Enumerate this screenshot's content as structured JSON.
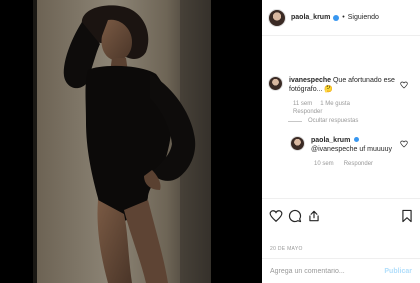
{
  "header": {
    "username": "paola_krum",
    "separator": "•",
    "follow_state": "Siguiendo",
    "verified_color": "#3897f0"
  },
  "comments": [
    {
      "username": "ivanespeche",
      "text": "Que afortunado ese fotógrafo... ",
      "emoji": "🤔",
      "time": "11 sem",
      "likes": "1 Me gusta",
      "reply_label": "Responder",
      "hide_replies": "Ocultar respuestas"
    }
  ],
  "reply": {
    "username": "paola_krum",
    "text": "@ivanespeche uf muuuuy",
    "time": "10 sem",
    "reply_label": "Responder"
  },
  "actions": {
    "icons": [
      "heart-icon",
      "comment-icon",
      "share-icon",
      "bookmark-icon"
    ]
  },
  "date": "20 DE MAYO",
  "add_comment": {
    "placeholder": "Agrega un comentario...",
    "publish_label": "Publicar",
    "publish_color": "#b2dffc"
  }
}
